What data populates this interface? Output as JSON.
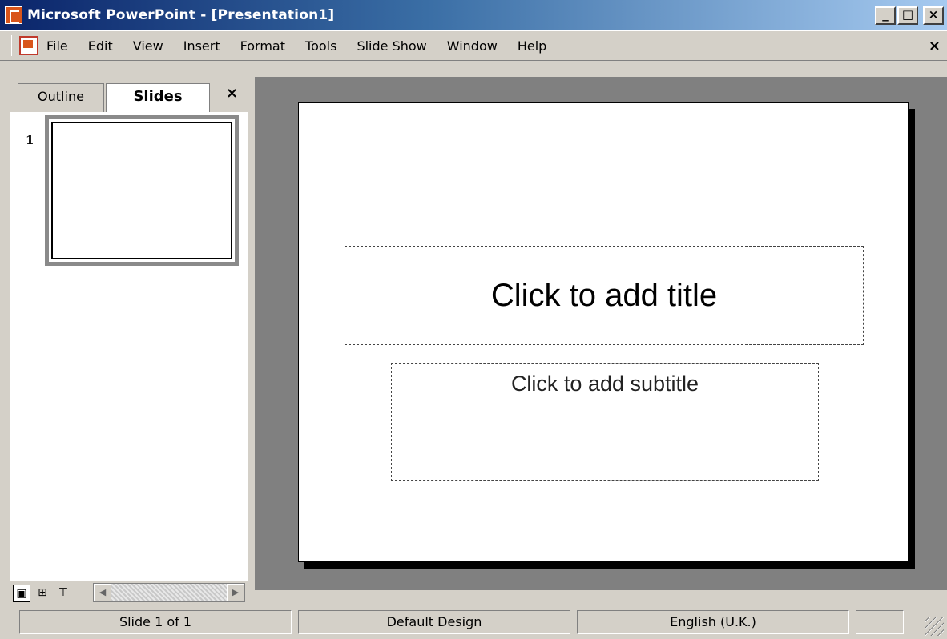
{
  "window": {
    "title": "Microsoft PowerPoint - [Presentation1]",
    "buttons": {
      "minimize": "_",
      "maximize": "□",
      "close": "×"
    }
  },
  "menu": {
    "items": [
      "File",
      "Edit",
      "View",
      "Insert",
      "Format",
      "Tools",
      "Slide Show",
      "Window",
      "Help"
    ],
    "close": "×"
  },
  "pane": {
    "tabs": {
      "outline": "Outline",
      "slides": "Slides"
    },
    "close": "×",
    "slide_number": "1"
  },
  "slide": {
    "title_placeholder": "Click to add title",
    "subtitle_placeholder": "Click to add subtitle"
  },
  "status": {
    "slide": "Slide 1 of 1",
    "design": "Default Design",
    "language": "English (U.K.)"
  },
  "icons": {
    "view_normal": "normal-view-icon",
    "view_sorter": "slide-sorter-icon",
    "view_show": "slide-show-icon"
  },
  "colors": {
    "titlebar_start": "#0a246a",
    "titlebar_end": "#a6caf0",
    "workspace": "#808080"
  }
}
